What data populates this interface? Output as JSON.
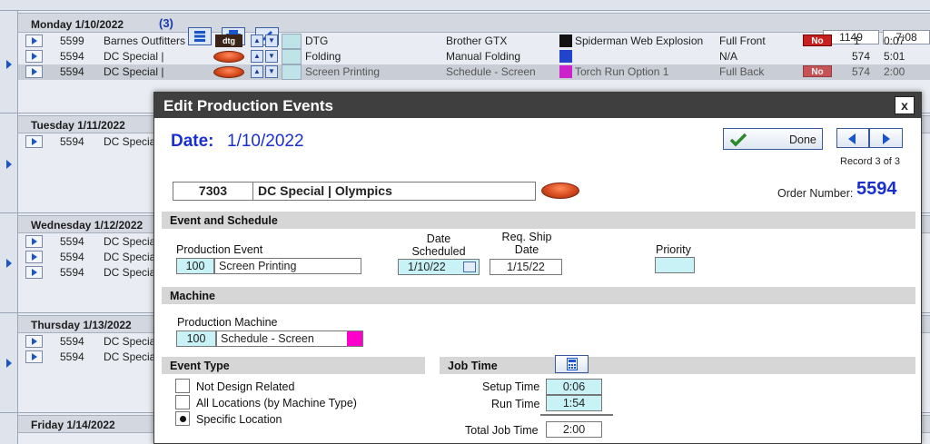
{
  "schedule": {
    "monday": {
      "label": "Monday 1/10/2022",
      "count": "(3)",
      "total_qty": "1149",
      "total_time": "7:08",
      "rows": [
        {
          "order": "5599",
          "customer": "Barnes Outfitters",
          "badge": "dtg",
          "event": "DTG",
          "machine": "Brother GTX",
          "color": "#111111",
          "design": "Spiderman Web Explosion",
          "location": "Full Front",
          "flag": "No",
          "qty": "1",
          "time": "0:07"
        },
        {
          "order": "5594",
          "customer": "DC Special |",
          "badge": "",
          "event": "Folding",
          "machine": "Manual Folding",
          "color": "#2244cc",
          "design": "",
          "location": "N/A",
          "flag": "",
          "qty": "574",
          "time": "5:01"
        },
        {
          "order": "5594",
          "customer": "DC Special |",
          "badge": "",
          "event": "Screen Printing",
          "machine": "Schedule - Screen",
          "color": "#cc22cc",
          "design": "Torch Run Option 1",
          "location": "Full Back",
          "flag": "No",
          "qty": "574",
          "time": "2:00"
        }
      ]
    },
    "tuesday": {
      "label": "Tuesday 1/11/2022",
      "rows": [
        {
          "order": "5594",
          "customer": "DC Specia"
        }
      ]
    },
    "wednesday": {
      "label": "Wednesday 1/12/2022",
      "rows": [
        {
          "order": "5594",
          "customer": "DC Specia"
        },
        {
          "order": "5594",
          "customer": "DC Specia"
        },
        {
          "order": "5594",
          "customer": "DC Specia"
        }
      ]
    },
    "thursday": {
      "label": "Thursday 1/13/2022",
      "rows": [
        {
          "order": "5594",
          "customer": "DC Specia"
        },
        {
          "order": "5594",
          "customer": "DC Specia"
        }
      ]
    },
    "friday": {
      "label": "Friday 1/14/2022"
    }
  },
  "modal": {
    "title": "Edit Production Events",
    "close_label": "x",
    "date_label": "Date:",
    "date_value": "1/10/2022",
    "done_label": "Done",
    "record_text": "Record 3 of 3",
    "order_id": "7303",
    "order_name": "DC Special | Olympics",
    "order_number_label": "Order Number:",
    "order_number": "5594",
    "sections": {
      "event_schedule": "Event and Schedule",
      "machine": "Machine",
      "event_type": "Event Type",
      "job_time": "Job Time"
    },
    "production_event": {
      "label": "Production Event",
      "code": "100",
      "name": "Screen Printing"
    },
    "date_scheduled": {
      "label1": "Date",
      "label2": "Scheduled",
      "value": "1/10/22"
    },
    "req_ship_date": {
      "label1": "Req. Ship",
      "label2": "Date",
      "value": "1/15/22"
    },
    "priority": {
      "label": "Priority",
      "value": ""
    },
    "production_machine": {
      "label": "Production Machine",
      "code": "100",
      "name": "Schedule - Screen",
      "color": "#ff00cc"
    },
    "event_type_options": [
      {
        "label": "Not Design Related",
        "selected": false
      },
      {
        "label": "All Locations (by Machine Type)",
        "selected": false
      },
      {
        "label": "Specific Location",
        "selected": true
      }
    ],
    "job_time": {
      "setup_label": "Setup Time",
      "setup_value": "0:06",
      "run_label": "Run Time",
      "run_value": "1:54",
      "total_label": "Total Job Time",
      "total_value": "2:00"
    }
  }
}
